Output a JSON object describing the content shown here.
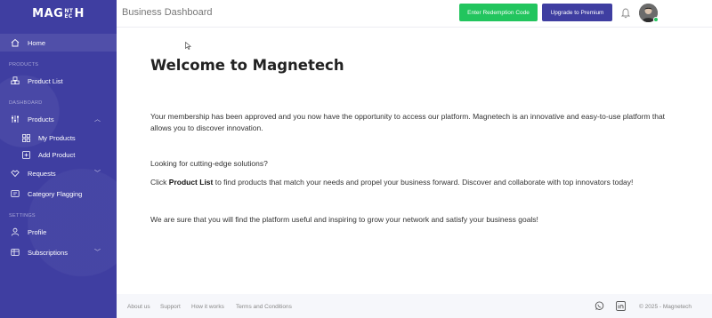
{
  "brand": {
    "logo_left": "MAG",
    "logo_small_top": "NT",
    "logo_small_bottom": "EC",
    "logo_right": "H"
  },
  "topbar": {
    "title": "Business Dashboard",
    "redeem_label": "Enter Redemption Code",
    "upgrade_label": "Upgrade to Premium"
  },
  "sidebar": {
    "home": "Home",
    "section_products": "PRODUCTS",
    "product_list": "Product List",
    "section_dashboard": "DASHBOARD",
    "products": "Products",
    "my_products": "My Products",
    "add_product": "Add Product",
    "requests": "Requests",
    "category_flagging": "Category Flagging",
    "section_settings": "SETTINGS",
    "profile": "Profile",
    "subscriptions": "Subscriptions"
  },
  "main": {
    "heading": "Welcome to Magnetech",
    "p1": "Your membership has been approved and you now have the opportunity to access our platform. Magnetech is an innovative and easy-to-use platform that allows you to discover innovation.",
    "p2": "Looking for cutting-edge solutions?",
    "p3_pre": "Click ",
    "p3_bold": "Product List",
    "p3_post": " to find products that match your needs and propel your business forward. Discover and collaborate with top innovators today!",
    "p4": "We are sure that you will find the platform useful and inspiring to grow your network and satisfy your business goals!"
  },
  "footer": {
    "about": "About us",
    "support": "Support",
    "how": "How it works",
    "terms": "Terms and Conditions",
    "copyright": "© 2025 - Magnetech"
  },
  "colors": {
    "sidebar": "#3f3ea1",
    "accent_green": "#22c55e",
    "accent_purple": "#3f3ea1"
  },
  "icons": [
    "home-icon",
    "cubes-icon",
    "sliders-icon",
    "grid-icon",
    "plus-box-icon",
    "handshake-icon",
    "flag-icon",
    "user-icon",
    "card-icon",
    "bell-icon",
    "whatsapp-icon",
    "linkedin-icon"
  ]
}
